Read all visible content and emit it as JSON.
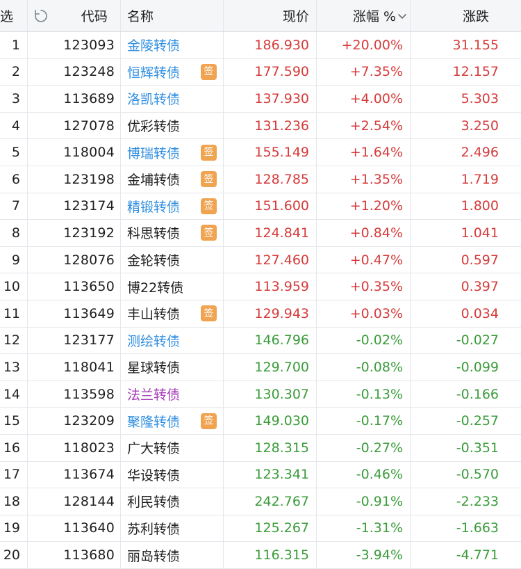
{
  "header": {
    "select_label": "选",
    "code_label": "代码",
    "name_label": "名称",
    "price_label": "现价",
    "pct_label": "涨幅 %",
    "change_label": "涨跌"
  },
  "colors": {
    "up": "#d63b3b",
    "down": "#3a9c3a",
    "link": "#2f8ee0",
    "special": "#a43ab8",
    "badge": "#f0a452"
  },
  "rows": [
    {
      "idx": "1",
      "code": "123093",
      "name": "金陵转债",
      "name_color": "blue",
      "badge": "",
      "price": "186.930",
      "pct": "+20.00%",
      "change": "31.155",
      "dir": "red"
    },
    {
      "idx": "2",
      "code": "123248",
      "name": "恒辉转债",
      "name_color": "blue",
      "badge": "签",
      "price": "177.590",
      "pct": "+7.35%",
      "change": "12.157",
      "dir": "red"
    },
    {
      "idx": "3",
      "code": "113689",
      "name": "洛凯转债",
      "name_color": "blue",
      "badge": "",
      "price": "137.930",
      "pct": "+4.00%",
      "change": "5.303",
      "dir": "red"
    },
    {
      "idx": "4",
      "code": "127078",
      "name": "优彩转债",
      "name_color": "black",
      "badge": "",
      "price": "131.236",
      "pct": "+2.54%",
      "change": "3.250",
      "dir": "red"
    },
    {
      "idx": "5",
      "code": "118004",
      "name": "博瑞转债",
      "name_color": "blue",
      "badge": "签",
      "price": "155.149",
      "pct": "+1.64%",
      "change": "2.496",
      "dir": "red"
    },
    {
      "idx": "6",
      "code": "123198",
      "name": "金埔转债",
      "name_color": "black",
      "badge": "签",
      "price": "128.785",
      "pct": "+1.35%",
      "change": "1.719",
      "dir": "red"
    },
    {
      "idx": "7",
      "code": "123174",
      "name": "精锻转债",
      "name_color": "blue",
      "badge": "签",
      "price": "151.600",
      "pct": "+1.20%",
      "change": "1.800",
      "dir": "red"
    },
    {
      "idx": "8",
      "code": "123192",
      "name": "科思转债",
      "name_color": "black",
      "badge": "签",
      "price": "124.841",
      "pct": "+0.84%",
      "change": "1.041",
      "dir": "red"
    },
    {
      "idx": "9",
      "code": "128076",
      "name": "金轮转债",
      "name_color": "black",
      "badge": "",
      "price": "127.460",
      "pct": "+0.47%",
      "change": "0.597",
      "dir": "red"
    },
    {
      "idx": "10",
      "code": "113650",
      "name": "博22转债",
      "name_color": "black",
      "badge": "",
      "price": "113.959",
      "pct": "+0.35%",
      "change": "0.397",
      "dir": "red"
    },
    {
      "idx": "11",
      "code": "113649",
      "name": "丰山转债",
      "name_color": "black",
      "badge": "签",
      "price": "129.943",
      "pct": "+0.03%",
      "change": "0.034",
      "dir": "red"
    },
    {
      "idx": "12",
      "code": "123177",
      "name": "测绘转债",
      "name_color": "blue",
      "badge": "",
      "price": "146.796",
      "pct": "-0.02%",
      "change": "-0.027",
      "dir": "green"
    },
    {
      "idx": "13",
      "code": "118041",
      "name": "星球转债",
      "name_color": "black",
      "badge": "",
      "price": "129.700",
      "pct": "-0.08%",
      "change": "-0.099",
      "dir": "green"
    },
    {
      "idx": "14",
      "code": "113598",
      "name": "法兰转债",
      "name_color": "purple",
      "badge": "",
      "price": "130.307",
      "pct": "-0.13%",
      "change": "-0.166",
      "dir": "green"
    },
    {
      "idx": "15",
      "code": "123209",
      "name": "聚隆转债",
      "name_color": "blue",
      "badge": "签",
      "price": "149.030",
      "pct": "-0.17%",
      "change": "-0.257",
      "dir": "green"
    },
    {
      "idx": "16",
      "code": "118023",
      "name": "广大转债",
      "name_color": "black",
      "badge": "",
      "price": "128.315",
      "pct": "-0.27%",
      "change": "-0.351",
      "dir": "green"
    },
    {
      "idx": "17",
      "code": "113674",
      "name": "华设转债",
      "name_color": "black",
      "badge": "",
      "price": "123.341",
      "pct": "-0.46%",
      "change": "-0.570",
      "dir": "green"
    },
    {
      "idx": "18",
      "code": "128144",
      "name": "利民转债",
      "name_color": "black",
      "badge": "",
      "price": "242.767",
      "pct": "-0.91%",
      "change": "-2.233",
      "dir": "green"
    },
    {
      "idx": "19",
      "code": "113640",
      "name": "苏利转债",
      "name_color": "black",
      "badge": "",
      "price": "125.267",
      "pct": "-1.31%",
      "change": "-1.663",
      "dir": "green"
    },
    {
      "idx": "20",
      "code": "113680",
      "name": "丽岛转债",
      "name_color": "black",
      "badge": "",
      "price": "116.315",
      "pct": "-3.94%",
      "change": "-4.771",
      "dir": "green"
    }
  ]
}
